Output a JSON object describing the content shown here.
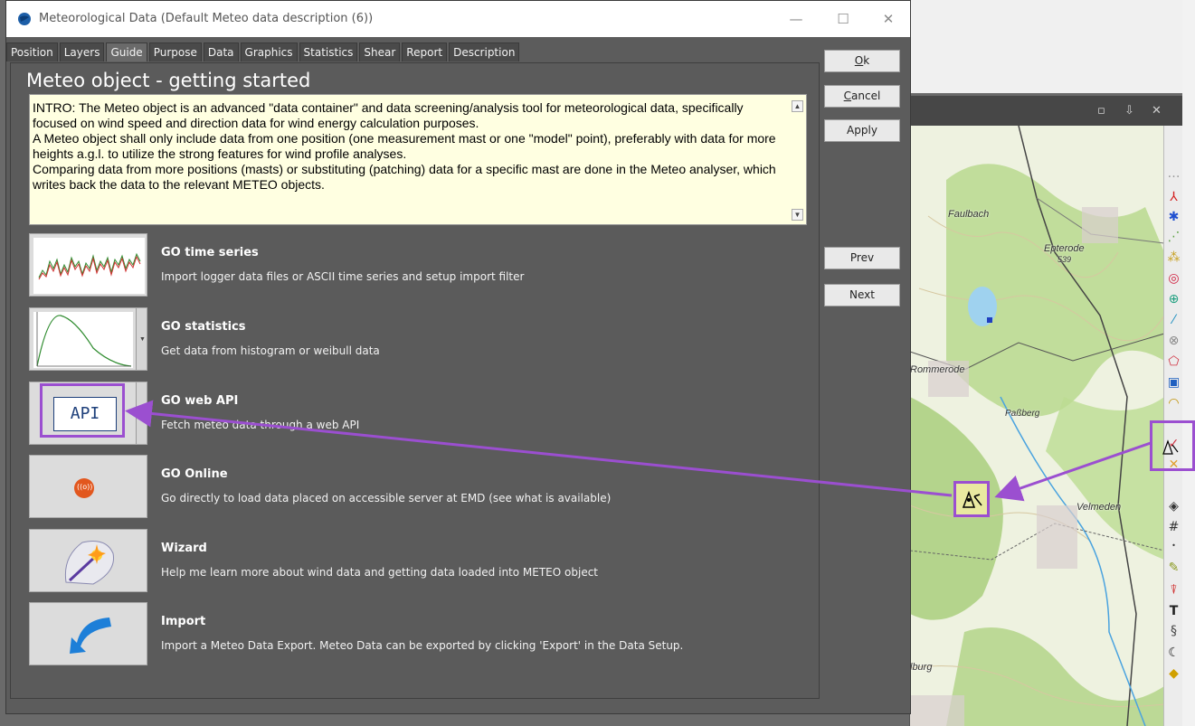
{
  "window": {
    "title": "Meteorological Data  (Default Meteo data description (6))",
    "minimize": "—",
    "maximize": "☐",
    "close": "✕"
  },
  "tabs": [
    {
      "label": "Position"
    },
    {
      "label": "Layers"
    },
    {
      "label": "Guide",
      "active": true
    },
    {
      "label": "Purpose"
    },
    {
      "label": "Data"
    },
    {
      "label": "Graphics"
    },
    {
      "label": "Statistics"
    },
    {
      "label": "Shear"
    },
    {
      "label": "Report"
    },
    {
      "label": "Description"
    }
  ],
  "guide": {
    "heading": "Meteo object - getting started",
    "intro": [
      "INTRO: The Meteo object is an advanced \"data container\" and data screening/analysis tool for meteorological data, specifically focused on wind speed and direction data for wind energy calculation purposes.",
      "A Meteo object shall only include data from one position (one measurement mast or one \"model\" point), preferably with data for more heights a.g.l. to utilize the strong features for wind profile analyses.",
      "Comparing data from more positions (masts) or substituting (patching) data for a specific mast are done in the Meteo analyser, which writes back the data to the relevant METEO objects."
    ],
    "items": [
      {
        "title": "GO time series",
        "desc": "Import logger data files or ASCII time series and setup import filter"
      },
      {
        "title": "GO statistics",
        "desc": "Get data from histogram or weibull data"
      },
      {
        "title": "GO web API",
        "desc": "Fetch meteo data through a web API",
        "thumb_label": "API"
      },
      {
        "title": "GO Online",
        "desc": "Go directly to load data placed on accessible server at EMD (see what is available)",
        "thumb_label": "((o))"
      },
      {
        "title": "Wizard",
        "desc": "Help me learn more about wind data and getting data loaded into METEO object"
      },
      {
        "title": "Import",
        "desc": "Import a Meteo Data Export. Meteo Data can be exported by clicking 'Export' in the Data Setup."
      }
    ]
  },
  "buttons": {
    "ok": {
      "hotkey": "O",
      "rest": "k"
    },
    "cancel": {
      "hotkey": "C",
      "rest": "ancel"
    },
    "apply": "Apply",
    "prev": "Prev",
    "next": "Next"
  },
  "map": {
    "labels": [
      "Faulbach",
      "Epterode",
      "539",
      "Rommerode",
      "Paßberg",
      "Velmeden",
      "lburg"
    ]
  },
  "colors": {
    "dialog_bg": "#5c5c5c",
    "intro_bg": "#ffffe1",
    "highlight": "#9b4fd0"
  }
}
